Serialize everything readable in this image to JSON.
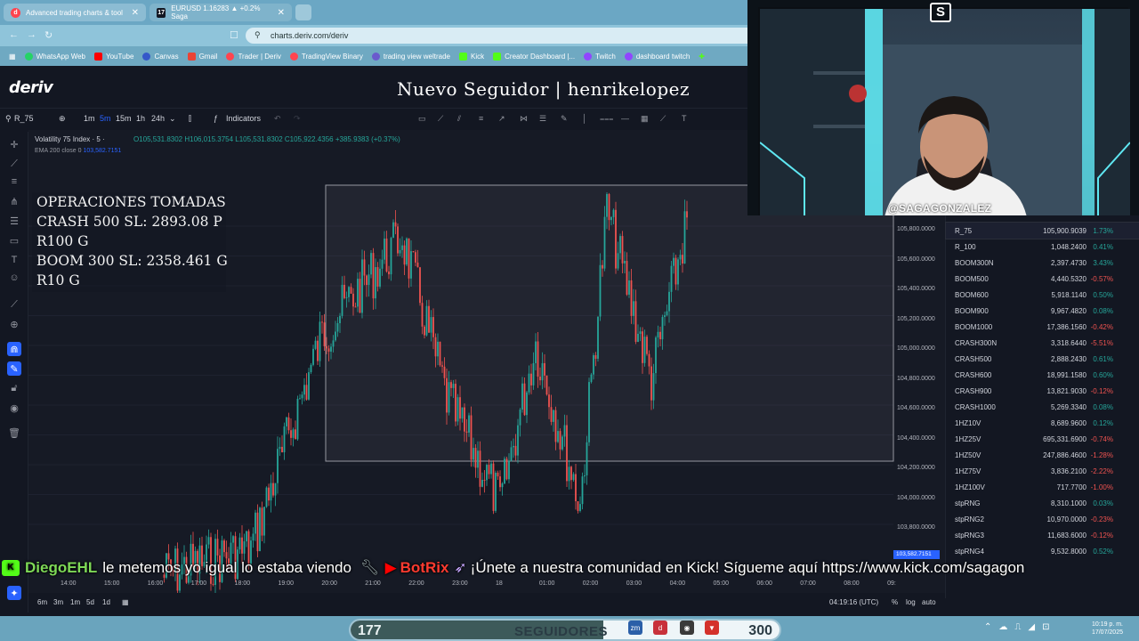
{
  "browser": {
    "tabs": [
      {
        "label": "Advanced trading charts & tool",
        "icon": "deriv-icon"
      },
      {
        "label": "EURUSD 1.16283 ▲ +0.2% Saga",
        "icon": "tradingview-icon"
      }
    ],
    "url": "charts.deriv.com/deriv",
    "bookmarks": [
      "WhatsApp Web",
      "YouTube",
      "Canvas",
      "Gmail",
      "Trader | Deriv",
      "TradingView Binary",
      "trading view weltrade",
      "Kick",
      "Creator Dashboard |...",
      "Twitch",
      "dashboard twitch"
    ]
  },
  "header": {
    "logo": "deriv",
    "alert": "Nuevo Seguidor | henrikelopez"
  },
  "toolbar": {
    "symbol": "R_75",
    "timeframes": [
      "1m",
      "5m",
      "15m",
      "1h",
      "24h"
    ],
    "active_timeframe": "5m",
    "indicators": "Indicators"
  },
  "legend": {
    "title": "Volatility 75 Index · 5 ·",
    "ohlc": "O105,531.8302 H106,015.3754 L105,531.8302 C105,922.4356 +385.9383 (+0.37%)",
    "ema_label": "EMA 200 close 0",
    "ema_value": "103,582.7151"
  },
  "ops": {
    "line1": "OPERACIONES TOMADAS",
    "line2": "CRASH 500 SL: 2893.08 P",
    "line3": "R100 G",
    "line4": "BOOM 300 SL: 2358.461 G",
    "line5": "R10 G"
  },
  "price_scale": [
    "105,800.0000",
    "105,600.0000",
    "105,400.0000",
    "105,200.0000",
    "105,000.0000",
    "104,800.0000",
    "104,600.0000",
    "104,400.0000",
    "104,200.0000",
    "104,000.0000",
    "103,800.0000"
  ],
  "last_price": "103,582.7151",
  "time_axis": [
    "14:00",
    "15:00",
    "16:00",
    "17:00",
    "18:00",
    "19:00",
    "20:00",
    "21:00",
    "22:00",
    "23:00",
    "18",
    "01:00",
    "02:00",
    "03:00",
    "04:00",
    "05:00",
    "06:00",
    "07:00",
    "08:00",
    "09:"
  ],
  "bottom": {
    "ranges": [
      "6m",
      "3m",
      "1m",
      "5d",
      "1d"
    ],
    "clock": "04:19:16 (UTC)",
    "pct": "%",
    "log": "log",
    "auto": "auto"
  },
  "watchlist": [
    {
      "sym": "R_75",
      "price": "105,900.9039",
      "chg": "1.73%",
      "dir": "pos"
    },
    {
      "sym": "R_100",
      "price": "1,048.2400",
      "chg": "0.41%",
      "dir": "pos"
    },
    {
      "sym": "BOOM300N",
      "price": "2,397.4730",
      "chg": "3.43%",
      "dir": "pos"
    },
    {
      "sym": "BOOM500",
      "price": "4,440.5320",
      "chg": "-0.57%",
      "dir": "neg"
    },
    {
      "sym": "BOOM600",
      "price": "5,918.1140",
      "chg": "0.50%",
      "dir": "pos"
    },
    {
      "sym": "BOOM900",
      "price": "9,967.4820",
      "chg": "0.08%",
      "dir": "pos"
    },
    {
      "sym": "BOOM1000",
      "price": "17,386.1560",
      "chg": "-0.42%",
      "dir": "neg"
    },
    {
      "sym": "CRASH300N",
      "price": "3,318.6440",
      "chg": "-5.51%",
      "dir": "neg"
    },
    {
      "sym": "CRASH500",
      "price": "2,888.2430",
      "chg": "0.61%",
      "dir": "pos"
    },
    {
      "sym": "CRASH600",
      "price": "18,991.1580",
      "chg": "0.60%",
      "dir": "pos"
    },
    {
      "sym": "CRASH900",
      "price": "13,821.9030",
      "chg": "-0.12%",
      "dir": "neg"
    },
    {
      "sym": "CRASH1000",
      "price": "5,269.3340",
      "chg": "0.08%",
      "dir": "pos"
    },
    {
      "sym": "1HZ10V",
      "price": "8,689.9600",
      "chg": "0.12%",
      "dir": "pos"
    },
    {
      "sym": "1HZ25V",
      "price": "695,331.6900",
      "chg": "-0.74%",
      "dir": "neg"
    },
    {
      "sym": "1HZ50V",
      "price": "247,886.4600",
      "chg": "-1.28%",
      "dir": "neg"
    },
    {
      "sym": "1HZ75V",
      "price": "3,836.2100",
      "chg": "-2.22%",
      "dir": "neg"
    },
    {
      "sym": "1HZ100V",
      "price": "717.7700",
      "chg": "-1.00%",
      "dir": "neg"
    },
    {
      "sym": "stpRNG",
      "price": "8,310.1000",
      "chg": "0.03%",
      "dir": "pos"
    },
    {
      "sym": "stpRNG2",
      "price": "10,970.0000",
      "chg": "-0.23%",
      "dir": "neg"
    },
    {
      "sym": "stpRNG3",
      "price": "11,683.6000",
      "chg": "-0.12%",
      "dir": "neg"
    },
    {
      "sym": "stpRNG4",
      "price": "9,532.8000",
      "chg": "0.52%",
      "dir": "pos"
    }
  ],
  "webcam": {
    "handle": "@SAGAGONZALEZ"
  },
  "chat": {
    "user1": "DiegoEHL",
    "msg1": "le metemos yo igual lo estaba viendo",
    "user2": "BotRix",
    "msg2": "¡Únete a nuestra comunidad en Kick! Sígueme aquí https://www.kick.com/sagagon"
  },
  "followers": {
    "current": "177",
    "label": "SEGUIDORES",
    "goal": "300",
    "progress": 0.59
  },
  "tray": {
    "time": "10:19 p. m.",
    "date": "17/07/2025"
  },
  "colors": {
    "up": "#26a69a",
    "down": "#ef5350",
    "accent": "#2962ff",
    "kick": "#53fc18"
  }
}
